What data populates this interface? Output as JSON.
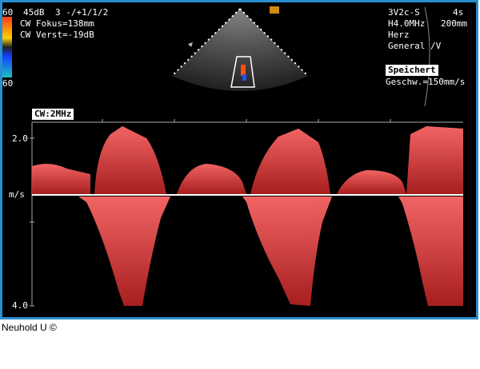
{
  "header": {
    "gain": "45dB",
    "mode": "3 -/+1/1/2",
    "focus": "CW Fokus=138mm",
    "gain2": "CW Verst=-19dB",
    "scale_top": "60",
    "scale_bottom": "60"
  },
  "probe": {
    "name": "3V2c-S",
    "freq": "H4.0MHz",
    "app": "Herz",
    "preset": "General /V",
    "time": "4s",
    "depth": "200mm",
    "stored": "Speichert",
    "sweep": "Geschw.=150mm/s"
  },
  "doppler": {
    "mode_label": "CW:2MHz",
    "tick_top": "2.0",
    "unit": "m/s",
    "tick_bottom": "4.0"
  },
  "caption": "Neuhold U ©",
  "colors": {
    "frame": "#2a8fd0",
    "spectrum": "#d23a3a",
    "background": "#000000"
  }
}
